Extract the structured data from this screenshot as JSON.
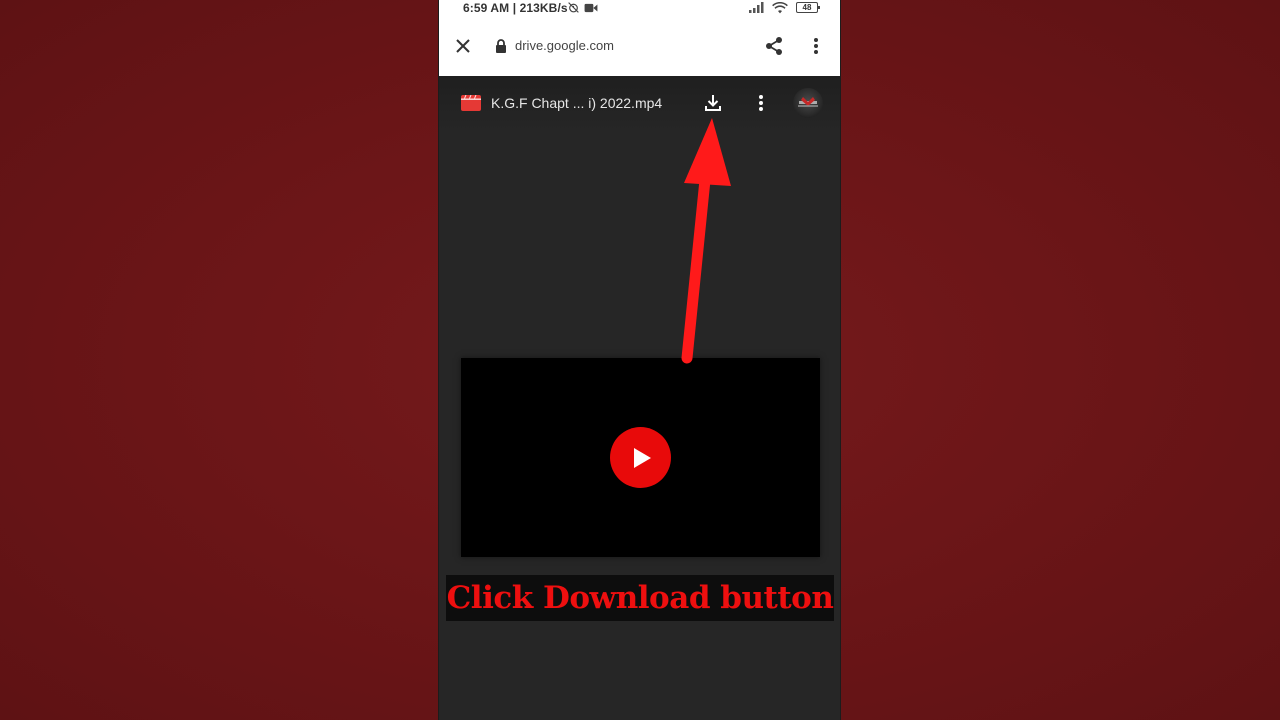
{
  "status_bar": {
    "time_and_speed": "6:59 AM | 213KB/s",
    "battery_level": "48"
  },
  "browser": {
    "url": "drive.google.com"
  },
  "drive_viewer": {
    "file_name": "K.G.F Chapt ... i) 2022.mp4"
  },
  "caption": {
    "text": "Click Download button"
  },
  "colors": {
    "background": "#6a1517",
    "viewer_background": "#262626",
    "play_button": "#e80a0a",
    "caption_text": "#ee0f0f",
    "arrow": "#ff1a1a",
    "file_icon": "#e53935"
  },
  "icons": {
    "close": "close-icon",
    "lock": "lock-icon",
    "share": "share-icon",
    "more": "more-vert-icon",
    "file_type": "video-file-icon",
    "download": "download-icon",
    "play": "play-icon"
  }
}
